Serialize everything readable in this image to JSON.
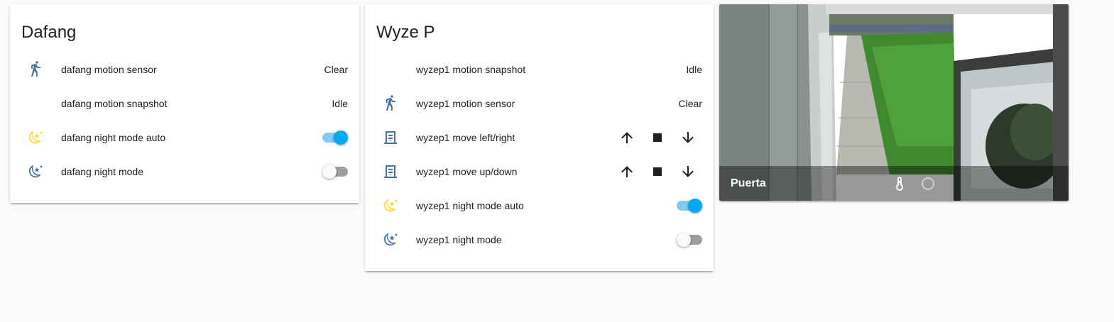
{
  "colors": {
    "icon_blue": "#44739e",
    "icon_yellow": "#fdd835",
    "toggle_on": "#03a9f4",
    "toggle_off": "#9e9e9e"
  },
  "dafang": {
    "title": "Dafang",
    "rows": [
      {
        "icon": "walk-icon",
        "name": "dafang motion sensor",
        "state": "Clear"
      },
      {
        "icon": "",
        "name": "dafang motion snapshot",
        "state": "Idle"
      },
      {
        "icon": "moon-stars-icon",
        "name": "dafang night mode auto",
        "toggle": "on"
      },
      {
        "icon": "moon-stars-icon",
        "name": "dafang night mode",
        "toggle": "off"
      }
    ]
  },
  "wyze": {
    "title": "Wyze P",
    "rows": [
      {
        "icon": "",
        "name": "wyzep1 motion snapshot",
        "state": "Idle"
      },
      {
        "icon": "walk-icon",
        "name": "wyzep1 motion sensor",
        "state": "Clear"
      },
      {
        "icon": "window-shutter-icon",
        "name": "wyzep1 move left/right",
        "controls": [
          "arrow-up",
          "stop",
          "arrow-down"
        ]
      },
      {
        "icon": "window-shutter-icon",
        "name": "wyzep1 move up/down",
        "controls": [
          "arrow-up",
          "stop",
          "arrow-down"
        ]
      },
      {
        "icon": "moon-stars-icon",
        "name": "wyzep1 night mode auto",
        "toggle": "on"
      },
      {
        "icon": "moon-stars-icon",
        "name": "wyzep1 night mode",
        "toggle": "off"
      }
    ]
  },
  "camera": {
    "title": "Puerta",
    "icons": [
      "thermometer-icon",
      "circle-outline-icon"
    ]
  }
}
